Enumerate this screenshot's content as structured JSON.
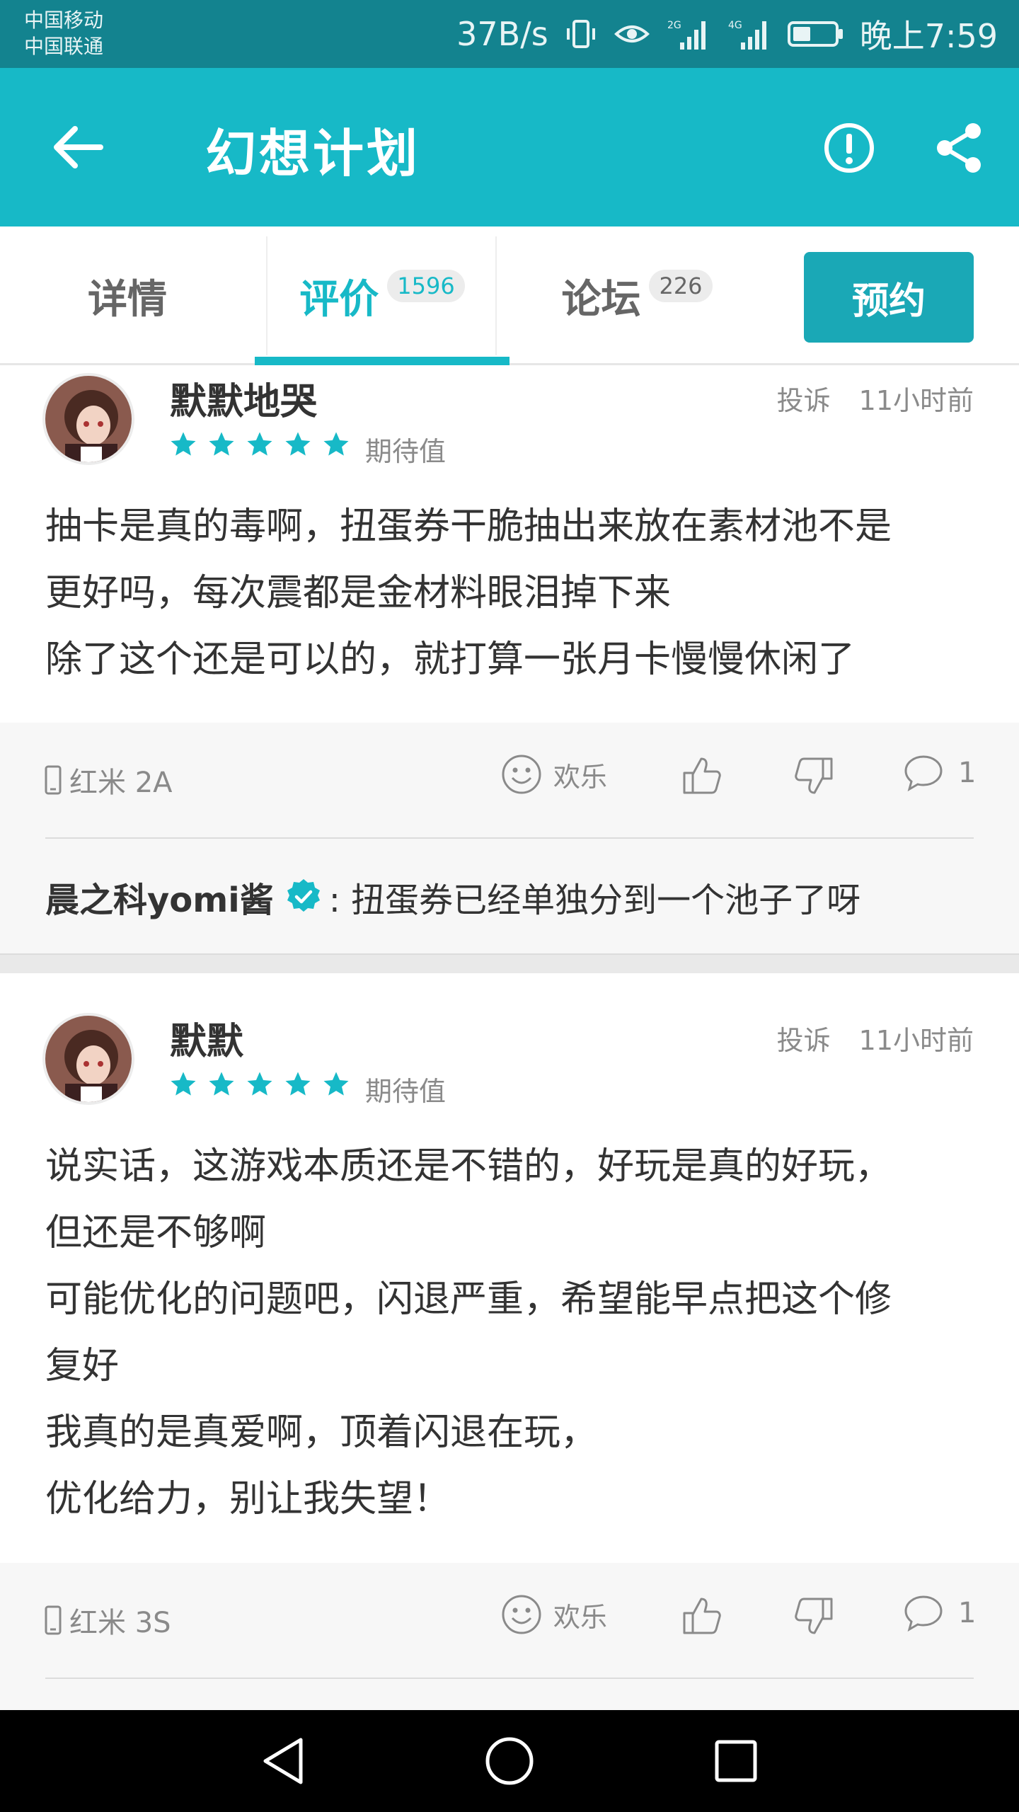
{
  "status_bar": {
    "carrier_1": "中国移动",
    "carrier_2": "中国联通",
    "speed": "37B/s",
    "time": "晚上7:59",
    "signal_1_label": "2G",
    "signal_2_label": "4G"
  },
  "app_bar": {
    "title": "幻想计划"
  },
  "tabs": [
    {
      "label": "详情",
      "count": ""
    },
    {
      "label": "评价",
      "count": "1596"
    },
    {
      "label": "论坛",
      "count": "226"
    }
  ],
  "reserve_label": "预约",
  "reviews": [
    {
      "username": "默默地哭",
      "report_label": "投诉",
      "time": "11小时前",
      "stars": 5,
      "rating_label": "期待值",
      "lines": [
        "抽卡是真的毒啊，扭蛋券干脆抽出来放在素材池不是",
        "更好吗，每次震都是金材料眼泪掉下来",
        "除了这个还是可以的，就打算一张月卡慢慢休闲了"
      ],
      "device": "红米 2A",
      "mood": "欢乐",
      "comment_count": "1",
      "reply": {
        "user": "晨之科yomi酱",
        "text": ": 扭蛋券已经单独分到一个池子了呀"
      }
    },
    {
      "username": "默默",
      "report_label": "投诉",
      "time": "11小时前",
      "stars": 5,
      "rating_label": "期待值",
      "lines": [
        "说实话，这游戏本质还是不错的，好玩是真的好玩，",
        "但还是不够啊",
        "可能优化的问题吧，闪退严重，希望能早点把这个修",
        "复好",
        "我真的是真爱啊，顶着闪退在玩，",
        "优化给力，别让我失望！"
      ],
      "device": "红米 3S",
      "mood": "欢乐",
      "comment_count": "1"
    }
  ],
  "colors": {
    "status_bar": "#13838f",
    "app_bar": "#17b9c7",
    "accent": "#17b9c7",
    "reserve_button": "#1aa8b6",
    "verified_badge": "#17b9c7"
  }
}
